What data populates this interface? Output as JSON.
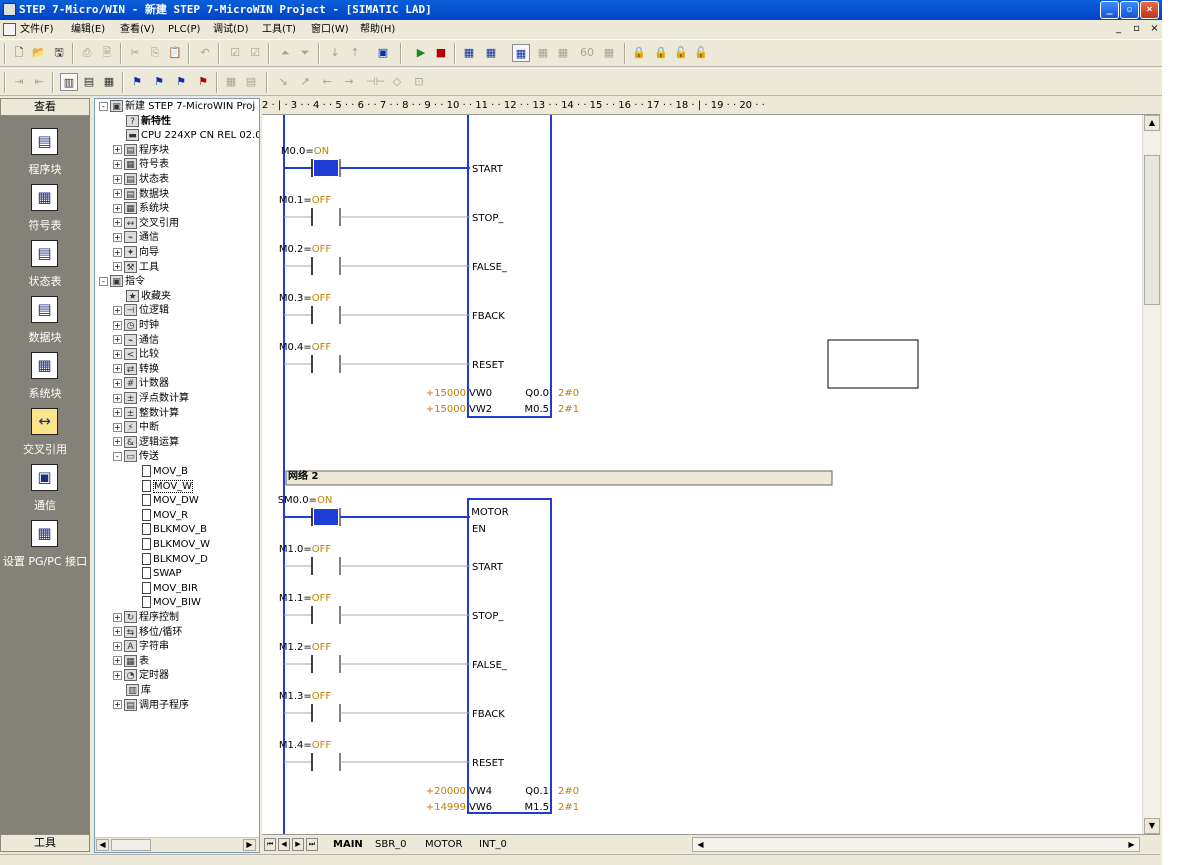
{
  "window": {
    "title": "STEP 7-Micro/WIN - 新建 STEP 7-MicroWIN Project - [SIMATIC LAD]",
    "minimize": "_",
    "maximize": "▫",
    "close": "×"
  },
  "menu": [
    "文件(F)",
    "编辑(E)",
    "查看(V)",
    "PLC(P)",
    "调试(D)",
    "工具(T)",
    "窗口(W)",
    "帮助(H)"
  ],
  "mdi_controls": [
    "_",
    "▫",
    "×"
  ],
  "left_panel": {
    "header": "查看",
    "items": [
      "程序块",
      "符号表",
      "状态表",
      "数据块",
      "系统块",
      "交叉引用",
      "通信",
      "设置 PG/PC 接口"
    ],
    "footer": "工具"
  },
  "tree": [
    {
      "text": "新建 STEP 7-MicroWIN Proj",
      "level": 0,
      "exp": "-"
    },
    {
      "text": "新特性",
      "level": 1,
      "exp": "",
      "bold": true
    },
    {
      "text": "CPU 224XP CN REL 02.0",
      "level": 1,
      "exp": ""
    },
    {
      "text": "程序块",
      "level": 1,
      "exp": "+"
    },
    {
      "text": "符号表",
      "level": 1,
      "exp": "+"
    },
    {
      "text": "状态表",
      "level": 1,
      "exp": "+"
    },
    {
      "text": "数据块",
      "level": 1,
      "exp": "+"
    },
    {
      "text": "系统块",
      "level": 1,
      "exp": "+"
    },
    {
      "text": "交叉引用",
      "level": 1,
      "exp": "+"
    },
    {
      "text": "通信",
      "level": 1,
      "exp": "+"
    },
    {
      "text": "向导",
      "level": 1,
      "exp": "+"
    },
    {
      "text": "工具",
      "level": 1,
      "exp": "+"
    },
    {
      "text": "指令",
      "level": 0,
      "exp": "-"
    },
    {
      "text": "收藏夹",
      "level": 1,
      "exp": ""
    },
    {
      "text": "位逻辑",
      "level": 1,
      "exp": "+"
    },
    {
      "text": "时钟",
      "level": 1,
      "exp": "+"
    },
    {
      "text": "通信",
      "level": 1,
      "exp": "+"
    },
    {
      "text": "比较",
      "level": 1,
      "exp": "+"
    },
    {
      "text": "转换",
      "level": 1,
      "exp": "+"
    },
    {
      "text": "计数器",
      "level": 1,
      "exp": "+"
    },
    {
      "text": "浮点数计算",
      "level": 1,
      "exp": "+"
    },
    {
      "text": "整数计算",
      "level": 1,
      "exp": "+"
    },
    {
      "text": "中断",
      "level": 1,
      "exp": "+"
    },
    {
      "text": "逻辑运算",
      "level": 1,
      "exp": "+"
    },
    {
      "text": "传送",
      "level": 1,
      "exp": "-"
    },
    {
      "text": "MOV_B",
      "level": 2,
      "exp": ""
    },
    {
      "text": "MOV_W",
      "level": 2,
      "exp": "",
      "selected": true
    },
    {
      "text": "MOV_DW",
      "level": 2,
      "exp": ""
    },
    {
      "text": "MOV_R",
      "level": 2,
      "exp": ""
    },
    {
      "text": "BLKMOV_B",
      "level": 2,
      "exp": ""
    },
    {
      "text": "BLKMOV_W",
      "level": 2,
      "exp": ""
    },
    {
      "text": "BLKMOV_D",
      "level": 2,
      "exp": ""
    },
    {
      "text": "SWAP",
      "level": 2,
      "exp": ""
    },
    {
      "text": "MOV_BIR",
      "level": 2,
      "exp": ""
    },
    {
      "text": "MOV_BIW",
      "level": 2,
      "exp": ""
    },
    {
      "text": "程序控制",
      "level": 1,
      "exp": "+"
    },
    {
      "text": "移位/循环",
      "level": 1,
      "exp": "+"
    },
    {
      "text": "字符串",
      "level": 1,
      "exp": "+"
    },
    {
      "text": "表",
      "level": 1,
      "exp": "+"
    },
    {
      "text": "定时器",
      "level": 1,
      "exp": "+"
    },
    {
      "text": "库",
      "level": 1,
      "exp": ""
    },
    {
      "text": "调用子程序",
      "level": 1,
      "exp": "+"
    }
  ],
  "ruler": "2 · | · 3 · · 4 · · 5 · · 6 · · 7 · · 8 · · 9 · · 10 · · 11 · · 12 · · 13 · · 14 · · 15 · · 16 · · 17 · · 18 · | · 19 · · 20 · ·",
  "network1": {
    "contacts": [
      {
        "addr": "M0.0",
        "state": "ON"
      },
      {
        "addr": "M0.1",
        "state": "OFF"
      },
      {
        "addr": "M0.2",
        "state": "OFF"
      },
      {
        "addr": "M0.3",
        "state": "OFF"
      },
      {
        "addr": "M0.4",
        "state": "OFF"
      }
    ],
    "pins": [
      "START",
      "STOP_",
      "FALSE_",
      "FBACK",
      "RESET"
    ],
    "in_vals": [
      {
        "val": "+15000",
        "pin": "VW0"
      },
      {
        "val": "+15000",
        "pin": "VW2"
      }
    ],
    "out_vals": [
      {
        "pin": "Q0.0",
        "val": "2#0"
      },
      {
        "pin": "M0.5",
        "val": "2#1"
      }
    ]
  },
  "network2": {
    "title": "网络 2",
    "block_name": "MOTOR",
    "en_contact": {
      "addr": "SM0.0",
      "state": "ON"
    },
    "en_pin": "EN",
    "contacts": [
      {
        "addr": "M1.0",
        "state": "OFF"
      },
      {
        "addr": "M1.1",
        "state": "OFF"
      },
      {
        "addr": "M1.2",
        "state": "OFF"
      },
      {
        "addr": "M1.3",
        "state": "OFF"
      },
      {
        "addr": "M1.4",
        "state": "OFF"
      }
    ],
    "pins": [
      "START",
      "STOP_",
      "FALSE_",
      "FBACK",
      "RESET"
    ],
    "in_vals": [
      {
        "val": "+20000",
        "pin": "VW4"
      },
      {
        "val": "+14999",
        "pin": "VW6"
      }
    ],
    "out_vals": [
      {
        "pin": "Q0.1",
        "val": "2#0"
      },
      {
        "pin": "M1.5",
        "val": "2#1"
      }
    ]
  },
  "tabs": [
    "MAIN",
    "SBR_0",
    "MOTOR",
    "INT_0"
  ],
  "colors": {
    "wire_on": "#1f3dd4",
    "block": "#1f3dd4",
    "value": "#c08000"
  }
}
